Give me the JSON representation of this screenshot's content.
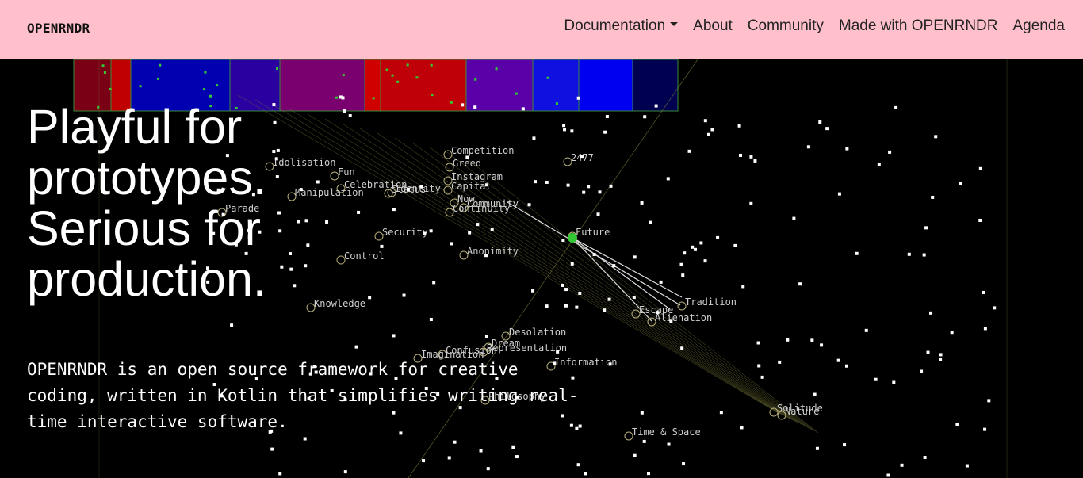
{
  "nav": {
    "brand": "OPENRNDR",
    "links": [
      "Documentation",
      "About",
      "Community",
      "Made with OPENRNDR",
      "Agenda"
    ]
  },
  "hero": {
    "lines": [
      "Playful for",
      "prototypes.",
      "Serious for",
      "production."
    ]
  },
  "intro": "OPENRNDR is an open source framework for creative coding, written in Kotlin that simplifies writing real-time interactive software.",
  "graph": {
    "labels": [
      "Idolisation",
      "Fun",
      "Celebration",
      "Identity",
      "Status",
      "Capital",
      "Manipulation",
      "Parade",
      "Competition",
      "Greed",
      "Instagram",
      "Now",
      "Community",
      "Continuity",
      "2477",
      "Future",
      "Security",
      "Control",
      "Anonimity",
      "Knowledge",
      "Escape",
      "Tradition",
      "Alienation",
      "Desolation",
      "Dream",
      "Confusion",
      "Representation",
      "Imagination",
      "Information",
      "Solitude",
      "Nature",
      "Time & Space",
      "Philosophy"
    ]
  },
  "colors": {
    "nav_bg": "#ffc0cb",
    "accent": "#34c734",
    "line": "#7a7a3a"
  }
}
